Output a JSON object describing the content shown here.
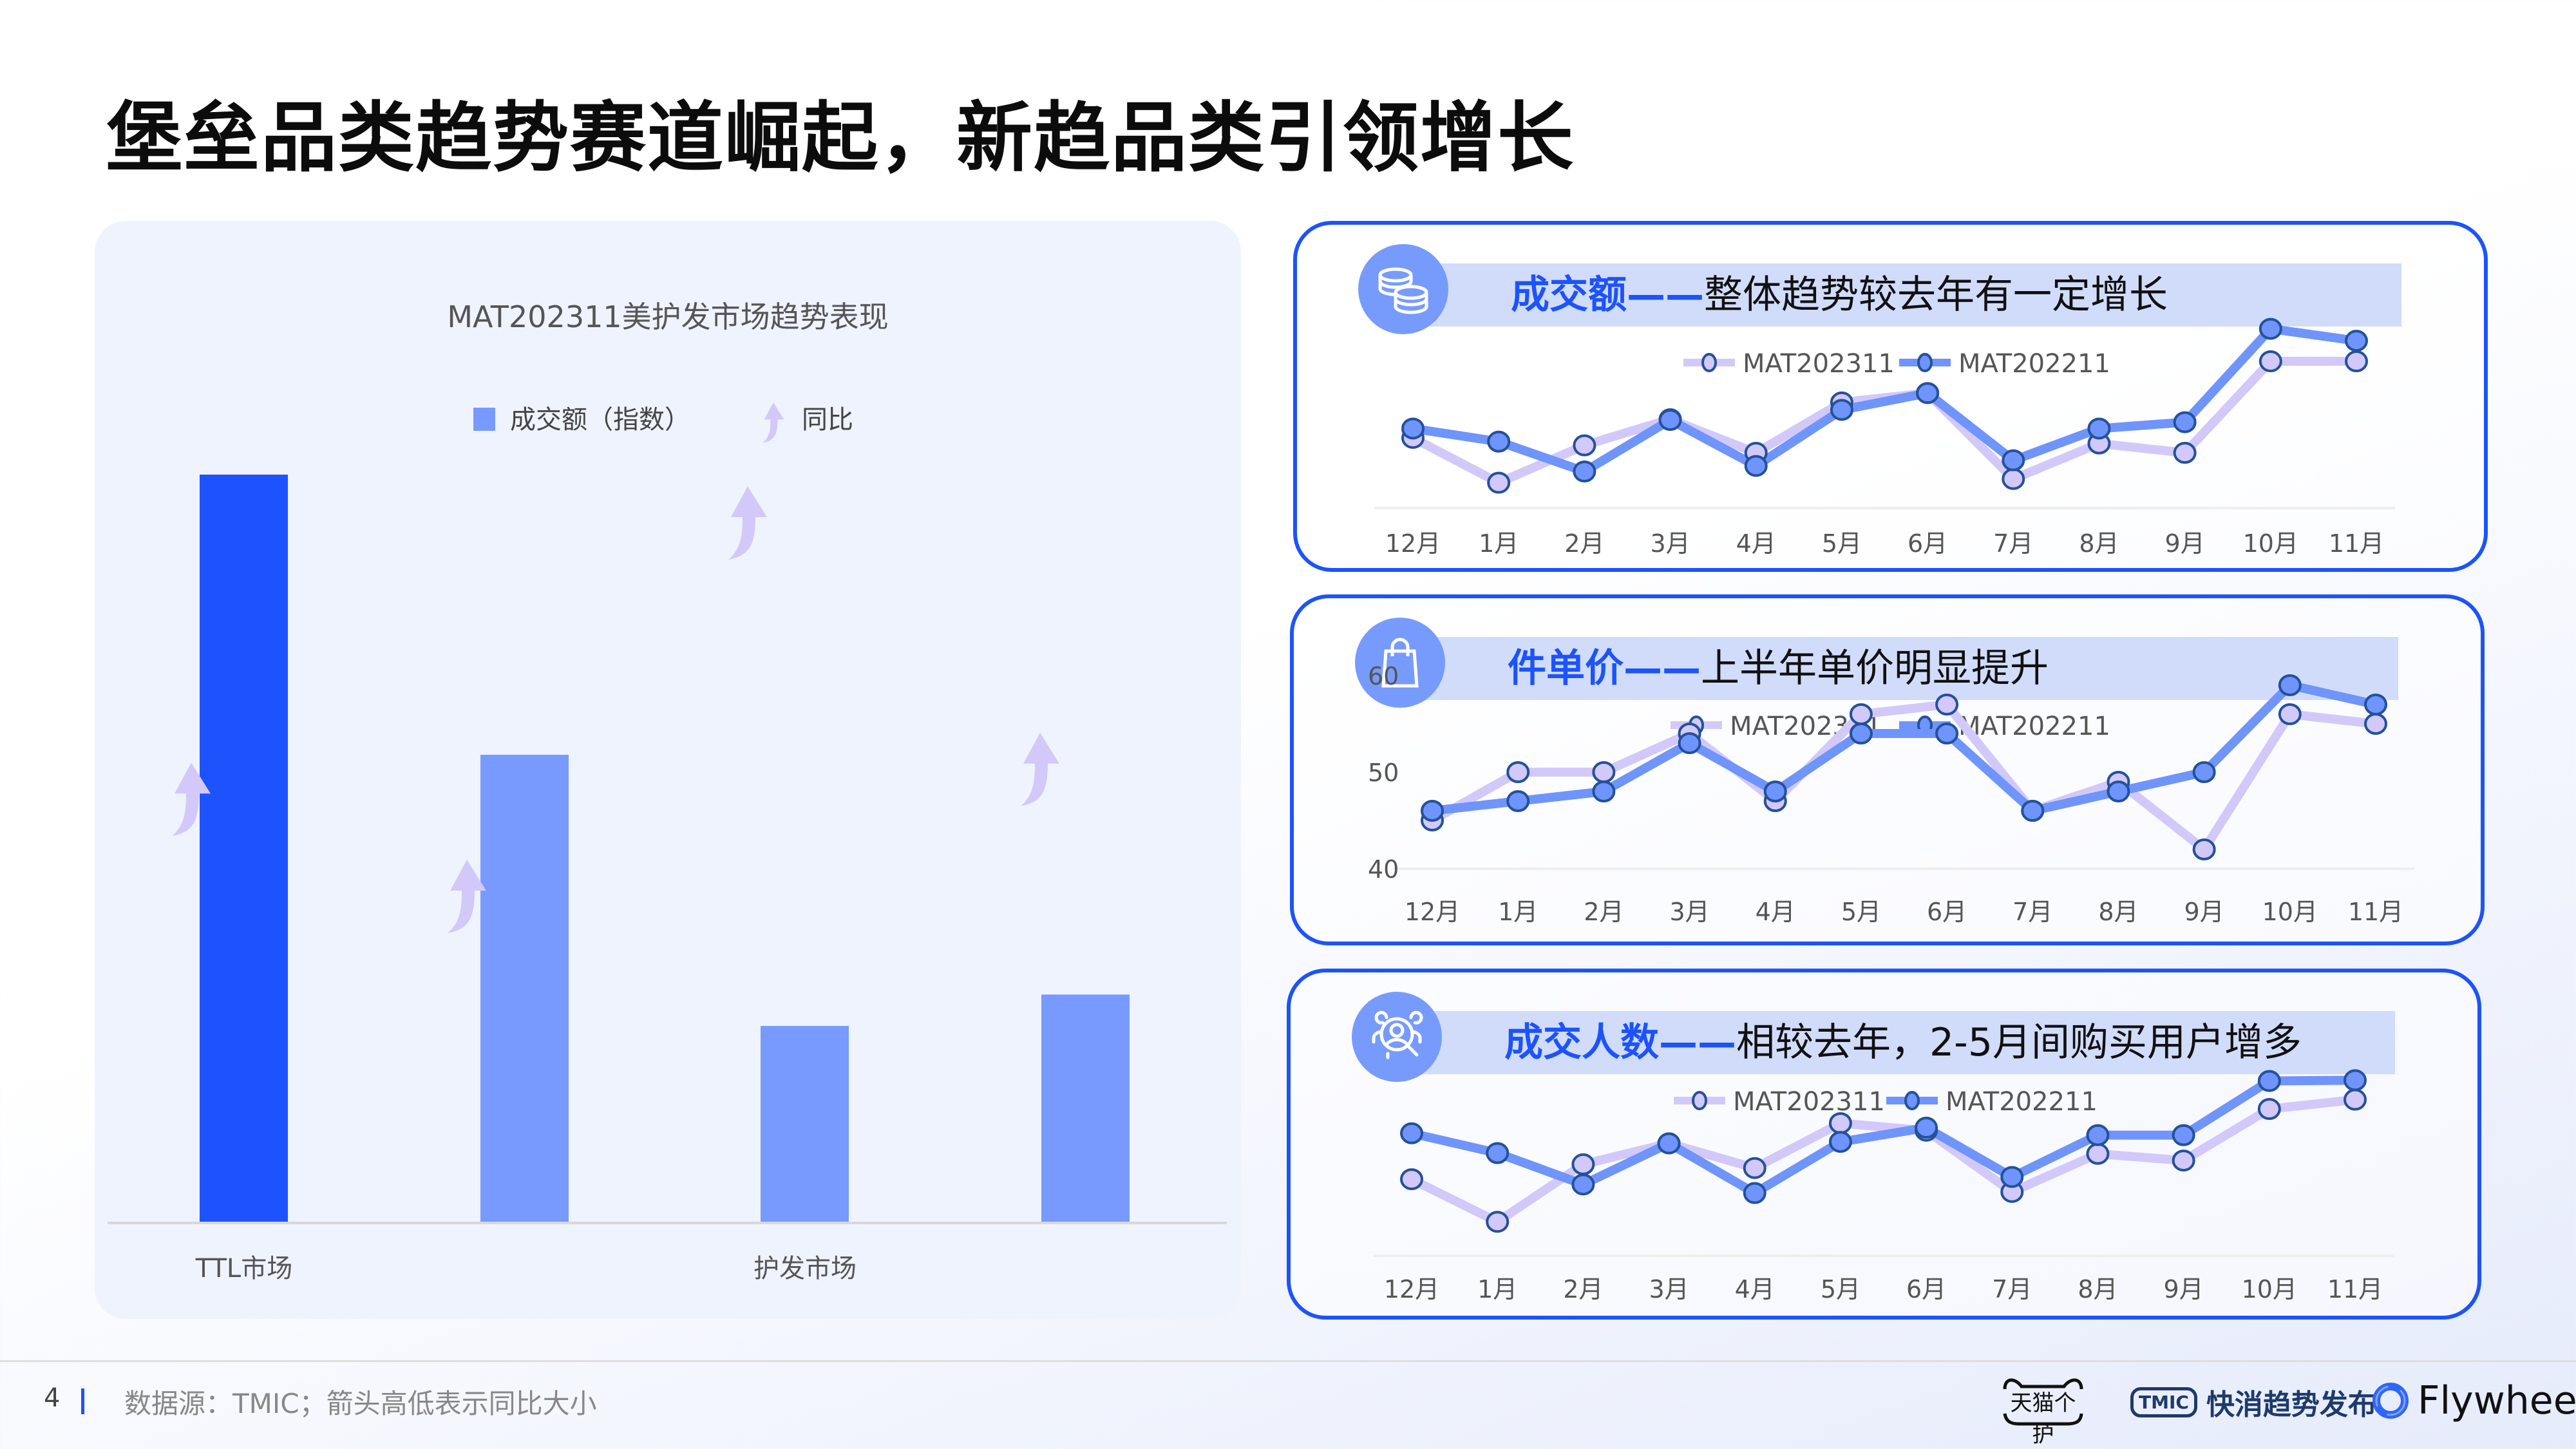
{
  "page": {
    "title": "堡垒品类趋势赛道崛起，新趋品类引领增长",
    "page_number": "4",
    "source_note": "数据源：TMIC；箭头高低表示同比大小"
  },
  "colors": {
    "accent": "#1c53fb",
    "bar_primary": "#1d53fd",
    "bar_secondary": "#789aff",
    "arrow": "#d2c9fa",
    "series_current": "#d2c9fa",
    "series_prev": "#6f94fb",
    "marker_stroke": "#24519a",
    "panel_bg": "#eff3fe"
  },
  "logos": {
    "tmall": "天猫个护",
    "tmic_badge": "TMIC",
    "tmic_text": "快消趋势发布",
    "flywheel": "Flywheel"
  },
  "kpi_panels": [
    {
      "icon": "coins-icon",
      "headline_highlight": "成交额——",
      "headline_rest": "整体趋势较去年有一定增长"
    },
    {
      "icon": "shopping-bag-icon",
      "headline_highlight": "件单价——",
      "headline_rest": "上半年单价明显提升"
    },
    {
      "icon": "user-search-icon",
      "headline_highlight": "成交人数——",
      "headline_rest": "相较去年，2-5月间购买用户增多"
    }
  ],
  "chart_data": [
    {
      "type": "bar",
      "title": "MAT202311美护发市场趋势表现",
      "legend": [
        "成交额（指数）",
        "同比"
      ],
      "legend_position": "top-center",
      "groups": [
        "TTL市场",
        "护发市场"
      ],
      "categories": [
        "TTL市场-1",
        "TTL市场-2",
        "护发市场-1",
        "护发市场-2"
      ],
      "category_labels_shown": [
        "TTL市场",
        "",
        "护发市场",
        ""
      ],
      "series": [
        {
          "name": "成交额（指数）",
          "values": [
            100,
            62.5,
            26.2,
            30.4
          ]
        }
      ],
      "yoy_arrows": {
        "name": "同比",
        "relative_height": [
          0.58,
          0.45,
          0.95,
          0.62
        ],
        "direction": [
          "up",
          "up",
          "up",
          "up"
        ]
      },
      "ylim": [
        0,
        100
      ],
      "xlabel": "",
      "ylabel": "",
      "grid": false
    },
    {
      "type": "line",
      "title": "成交额",
      "x": [
        "12月",
        "1月",
        "2月",
        "3月",
        "4月",
        "5月",
        "6月",
        "7月",
        "8月",
        "9月",
        "10月",
        "11月"
      ],
      "series": [
        {
          "name": "MAT202311",
          "values": [
            18.8,
            6.8,
            16.8,
            23.8,
            14.8,
            28.3,
            30.8,
            7.8,
            17.3,
            14.8,
            39.3,
            39.3
          ]
        },
        {
          "name": "MAT202211",
          "values": [
            21.3,
            17.8,
            9.8,
            23.6,
            11.3,
            26.3,
            30.8,
            12.8,
            21.3,
            23.0,
            48.0,
            44.8
          ]
        }
      ],
      "ylim": [
        0,
        50
      ],
      "y_axis_visible": false,
      "legend_position": "top-center",
      "grid": false
    },
    {
      "type": "line",
      "title": "件单价",
      "x": [
        "12月",
        "1月",
        "2月",
        "3月",
        "4月",
        "5月",
        "6月",
        "7月",
        "8月",
        "9月",
        "10月",
        "11月"
      ],
      "series": [
        {
          "name": "MAT202311",
          "values": [
            45,
            50,
            50,
            54,
            47,
            56,
            57,
            46,
            49,
            42,
            56,
            55
          ]
        },
        {
          "name": "MAT202211",
          "values": [
            46,
            47,
            48,
            53,
            48,
            54,
            54,
            46,
            48,
            50,
            59,
            57
          ]
        }
      ],
      "ylim": [
        40,
        60
      ],
      "yticks": [
        "40",
        "50",
        "60"
      ],
      "y_axis_visible": true,
      "legend_position": "top-center",
      "grid": false
    },
    {
      "type": "line",
      "title": "成交人数",
      "x": [
        "12月",
        "1月",
        "2月",
        "3月",
        "4月",
        "5月",
        "6月",
        "7月",
        "8月",
        "9月",
        "10月",
        "11月"
      ],
      "series": [
        {
          "name": "MAT202311",
          "values": [
            20.5,
            9.1,
            24.5,
            30.1,
            23.5,
            35.5,
            33.5,
            17.1,
            27.3,
            25.5,
            39.3,
            41.8
          ]
        },
        {
          "name": "MAT202211",
          "values": [
            32.8,
            27.5,
            19.1,
            30.1,
            16.8,
            30.5,
            34.3,
            21.1,
            32.3,
            32.3,
            46.8,
            47.0
          ]
        }
      ],
      "ylim": [
        0,
        50
      ],
      "y_axis_visible": false,
      "legend_position": "top-center",
      "grid": false
    }
  ]
}
